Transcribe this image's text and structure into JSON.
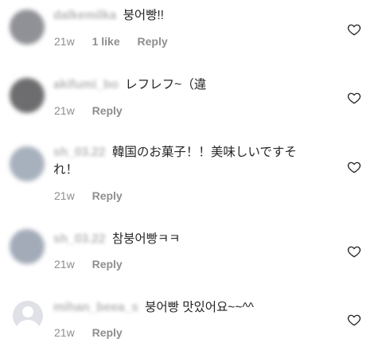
{
  "comments": [
    {
      "username": "dalkemilka",
      "text": "붕어빵!!",
      "time": "21w",
      "likes": "1 like",
      "reply": "Reply",
      "avatar_color": "#8f9196"
    },
    {
      "username": "akifumi_bo",
      "text": "レフレフ~（違",
      "time": "21w",
      "likes": "",
      "reply": "Reply",
      "avatar_color": "#6d6d6f"
    },
    {
      "username": "sh_03.22",
      "text": "韓国のお菓子！！美味しいですそれ！",
      "time": "21w",
      "likes": "",
      "reply": "Reply",
      "avatar_color": "#a7b0bd"
    },
    {
      "username": "sh_03.22",
      "text": "참붕어빵ㅋㅋ",
      "time": "21w",
      "likes": "",
      "reply": "Reply",
      "avatar_color": "#a3abb8"
    },
    {
      "username": "mihan_beea_s",
      "text": "붕어빵 맛있어요~~^^",
      "time": "21w",
      "likes": "",
      "reply": "Reply",
      "avatar_color": "#dfe1e6"
    }
  ]
}
